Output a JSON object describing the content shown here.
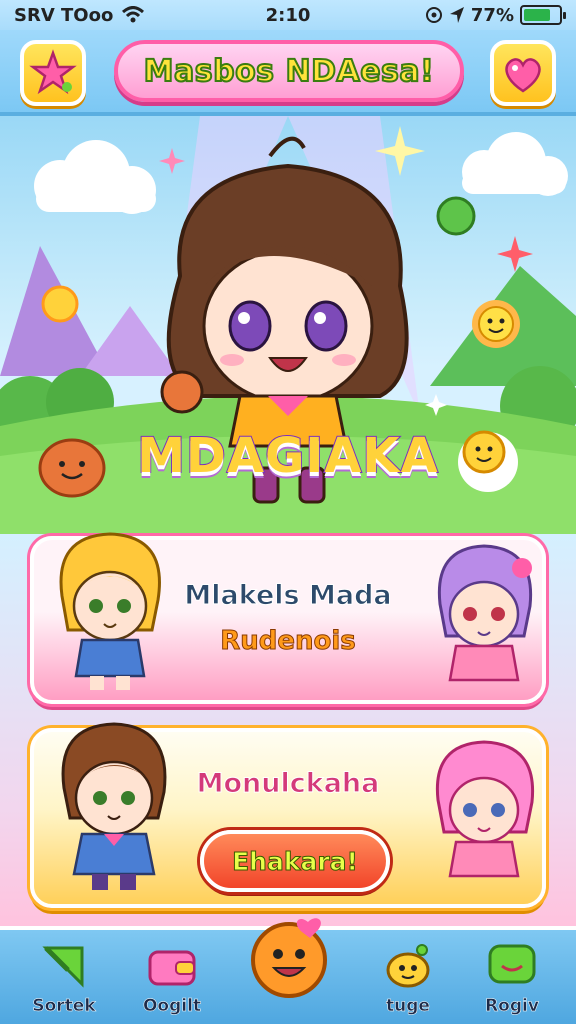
{
  "status_bar": {
    "carrier": "SRV TOoo",
    "time": "2:10",
    "battery": "77%",
    "battery_level": 0.77
  },
  "header": {
    "title": "Masbos NDAesa!",
    "left_button_icon": "star-icon",
    "right_button_icon": "heart-icon"
  },
  "scene": {
    "logo": "MDAGIAKA"
  },
  "cards": [
    {
      "title": "Mlakels Mada",
      "subtitle": "Rudenois"
    },
    {
      "title": "Monulckaha",
      "button_label": "Ehakara!"
    }
  ],
  "nav": {
    "items": [
      {
        "label": "Sortek",
        "icon": "arrow-icon"
      },
      {
        "label": "Oogilt",
        "icon": "wallet-icon"
      },
      {
        "label": "",
        "icon": "smiley-icon"
      },
      {
        "label": "tuge",
        "icon": "bee-icon"
      },
      {
        "label": "Rogiv",
        "icon": "chat-icon"
      }
    ]
  },
  "colors": {
    "title_pill": "#ff9fd3",
    "card_pink": "#ff6aa8",
    "card_yellow": "#ffb22c",
    "action_button": "#f2452a",
    "nav_bar": "#4fa7e0"
  }
}
